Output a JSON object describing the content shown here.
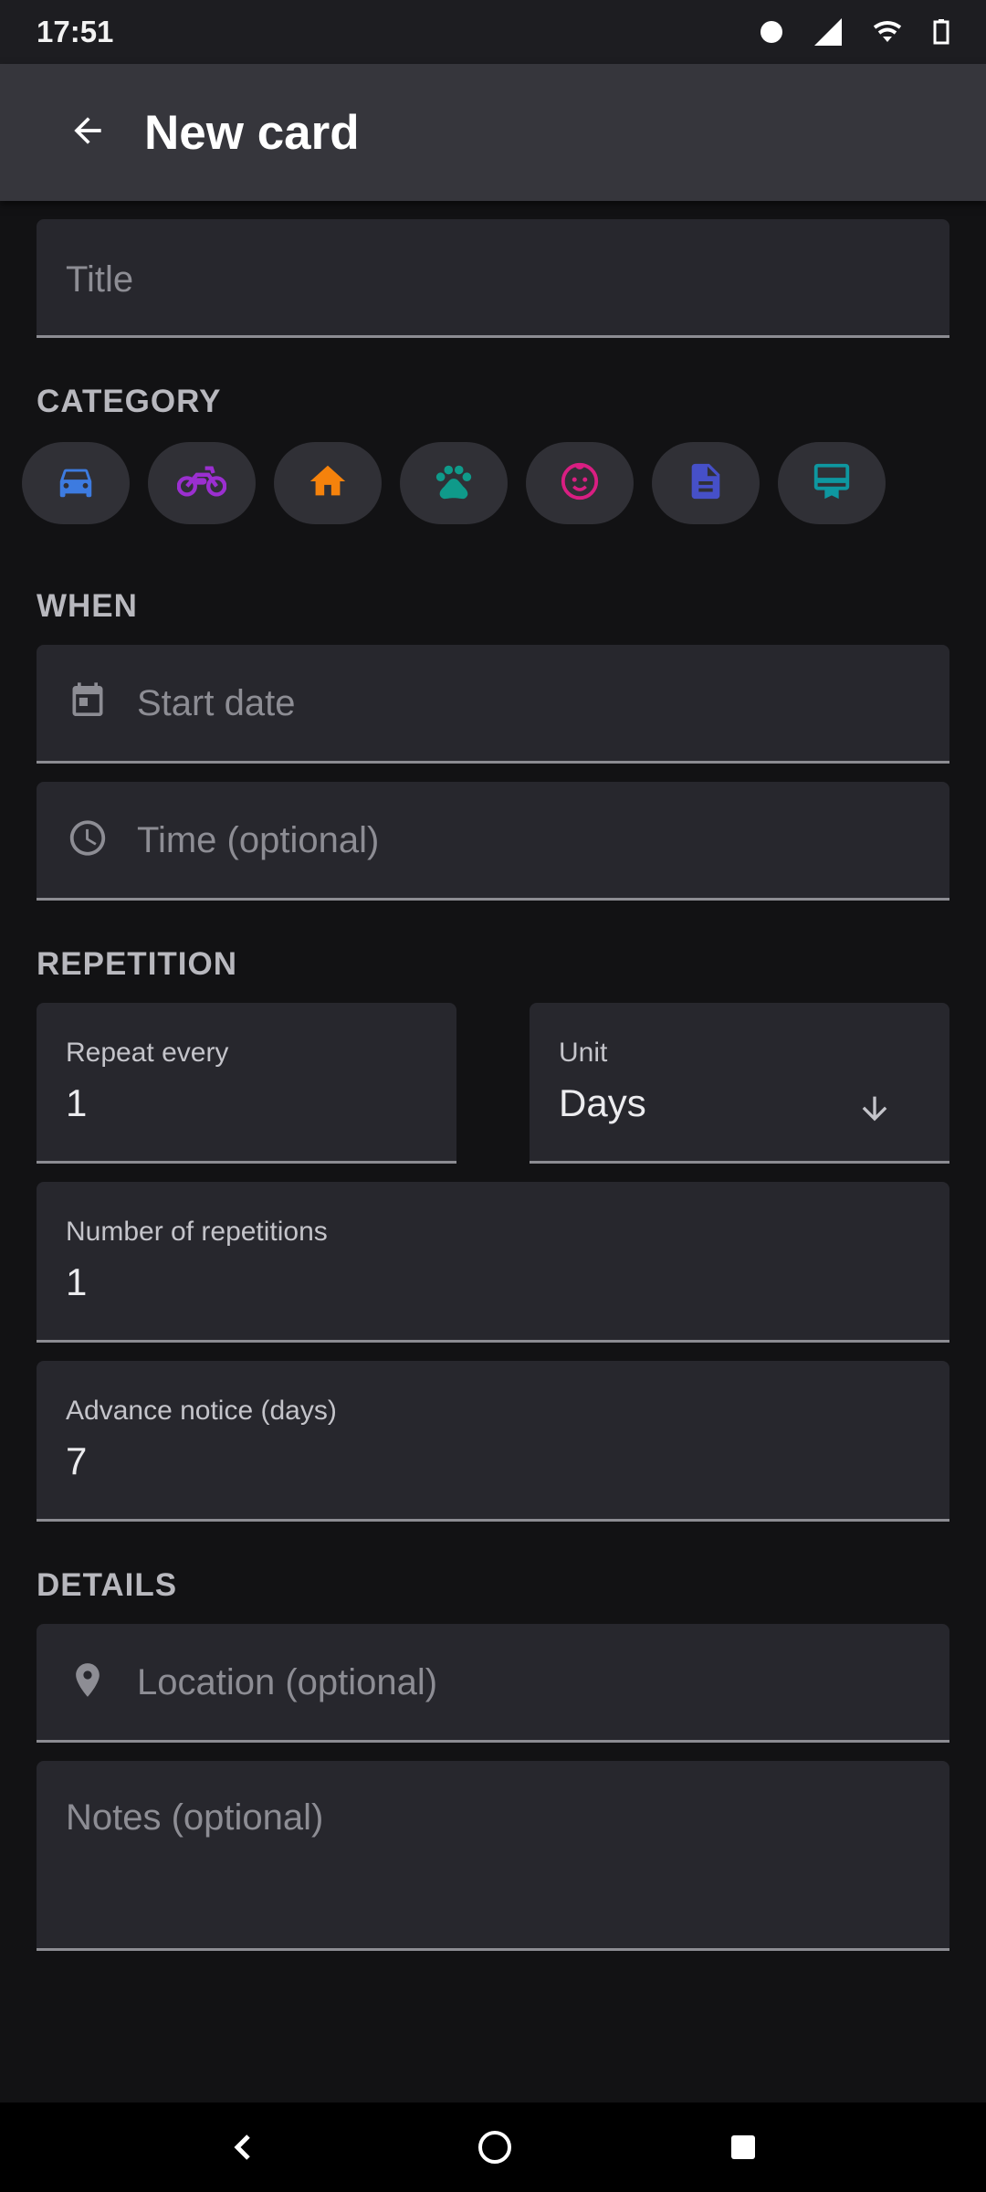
{
  "status_bar": {
    "time": "17:51",
    "icons": [
      "notification-dot-icon",
      "signal-icon",
      "wifi-icon",
      "battery-icon"
    ]
  },
  "app_bar": {
    "title": "New card",
    "back_icon": "arrow-back-icon"
  },
  "title_field": {
    "placeholder": "Title"
  },
  "category": {
    "header": "CATEGORY",
    "chips": [
      {
        "icon": "car-icon",
        "color": "#3d7be0"
      },
      {
        "icon": "motorcycle-icon",
        "color": "#9b2fd0"
      },
      {
        "icon": "home-icon",
        "color": "#f5820c"
      },
      {
        "icon": "paw-icon",
        "color": "#0f9a8a"
      },
      {
        "icon": "child-face-icon",
        "color": "#d91e82"
      },
      {
        "icon": "document-icon",
        "color": "#4650c8"
      },
      {
        "icon": "card-membership-icon",
        "color": "#0e97a0"
      }
    ]
  },
  "when": {
    "header": "WHEN",
    "start_date": {
      "placeholder": "Start date",
      "icon": "calendar-icon"
    },
    "time": {
      "placeholder": "Time (optional)",
      "icon": "clock-icon"
    }
  },
  "repetition": {
    "header": "REPETITION",
    "repeat_every": {
      "label": "Repeat every",
      "value": "1"
    },
    "unit": {
      "label": "Unit",
      "value": "Days",
      "icon": "arrow-down-icon"
    },
    "number_of_repetitions": {
      "label": "Number of repetitions",
      "value": "1"
    },
    "advance_notice": {
      "label": "Advance notice (days)",
      "value": "7"
    }
  },
  "details": {
    "header": "DETAILS",
    "location": {
      "placeholder": "Location (optional)",
      "icon": "location-pin-icon"
    },
    "notes": {
      "placeholder": "Notes (optional)"
    }
  },
  "nav_bar": {
    "icons": [
      "nav-back-icon",
      "nav-home-icon",
      "nav-recents-icon"
    ]
  }
}
